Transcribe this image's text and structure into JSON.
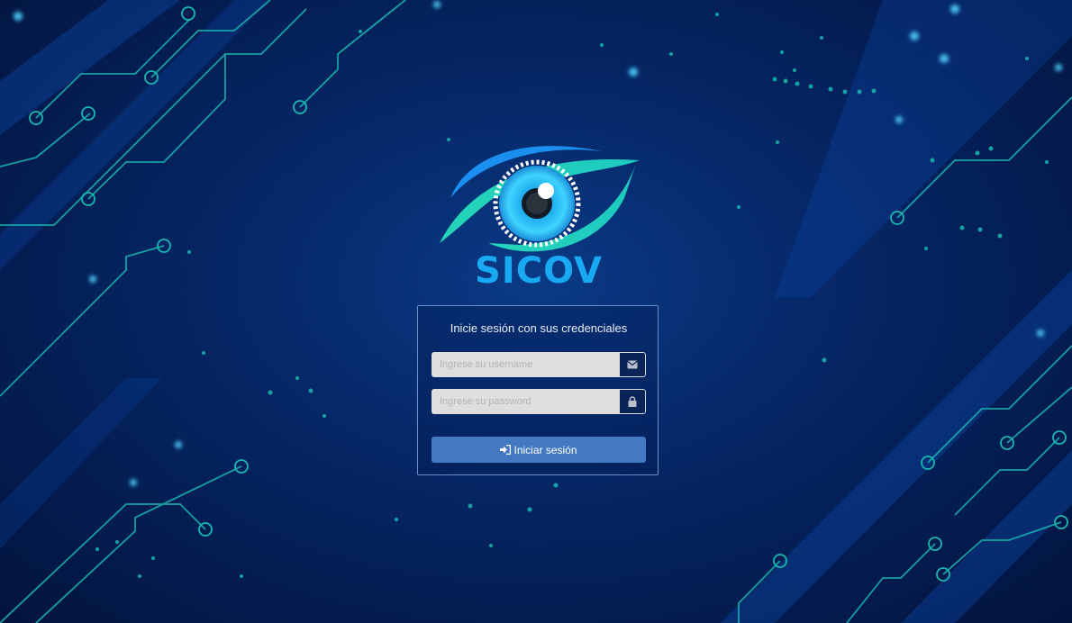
{
  "app": {
    "name": "SICOV"
  },
  "login": {
    "title": "Inicie sesión con sus credenciales",
    "username_placeholder": "Ingrese su username",
    "username_value": "",
    "username_icon": "envelope-icon",
    "password_placeholder": "Ingrese su password",
    "password_value": "",
    "password_icon": "lock-icon",
    "submit_label": "Iniciar sesión",
    "submit_icon": "sign-in-icon"
  },
  "colors": {
    "background": "#06296a",
    "logo_text": "#18a9f2",
    "button": "#4279c1",
    "card_border": "#6f8fc8",
    "circuit": "#1ab7b0"
  }
}
